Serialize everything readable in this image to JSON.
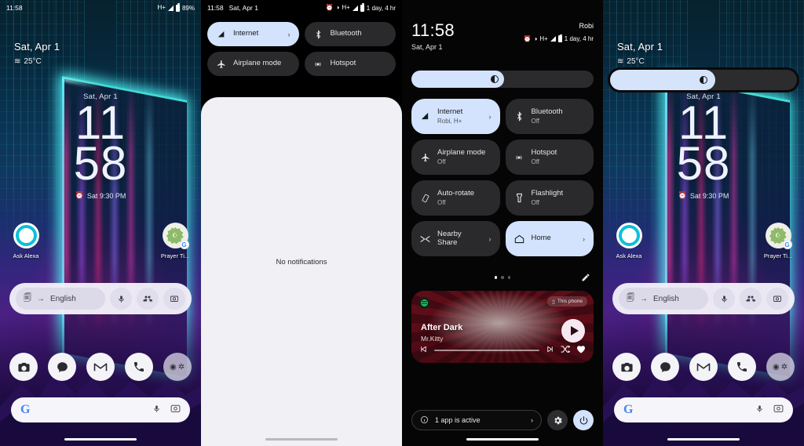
{
  "panels": {
    "home": {
      "status": {
        "time": "11:58",
        "network": "H+",
        "battery_pct": "89%"
      },
      "date": "Sat, Apr 1",
      "weather": "25°C",
      "clock": {
        "date": "Sat, Apr 1",
        "hours": "11",
        "minutes": "58",
        "alarm": "Sat 9:30 PM"
      },
      "icons": [
        {
          "label": "Ask Alexa",
          "icon": "alexa-icon"
        },
        {
          "label": "Prayer Ti...",
          "icon": "prayer-times-icon"
        }
      ],
      "translate_widget": {
        "language": "English",
        "arrow": "→",
        "buttons": [
          "mic-icon",
          "conversation-icon",
          "camera-icon"
        ],
        "lens_icon": "translate-lens-icon"
      },
      "dock": [
        "camera-icon",
        "messages-icon",
        "gmail-icon",
        "phone-icon",
        "folder-icon"
      ],
      "search": {
        "logo": "google-g",
        "placeholder": "",
        "mic": "mic-icon",
        "lens": "lens-icon"
      }
    },
    "notifications": {
      "status": {
        "time": "11:58",
        "date": "Sat, Apr 1",
        "battery_text": "1 day, 4 hr",
        "network": "H+"
      },
      "tiles": [
        {
          "label": "Internet",
          "state": "on",
          "chevron": "›",
          "icon": "signal-icon"
        },
        {
          "label": "Bluetooth",
          "state": "off",
          "icon": "bluetooth-icon"
        },
        {
          "label": "Airplane mode",
          "state": "off",
          "icon": "airplane-icon"
        },
        {
          "label": "Hotspot",
          "state": "off",
          "icon": "hotspot-icon"
        }
      ],
      "empty_text": "No notifications"
    },
    "quicksettings": {
      "time": "11:58",
      "date": "Sat, Apr 1",
      "carrier": "Robi",
      "battery_text": "1 day, 4 hr",
      "network": "H+",
      "brightness_pct": 51,
      "tiles": [
        {
          "label": "Internet",
          "sub": "Robi, H+",
          "state": "on",
          "chevron": "›",
          "icon": "signal-icon"
        },
        {
          "label": "Bluetooth",
          "sub": "Off",
          "state": "off",
          "icon": "bluetooth-icon"
        },
        {
          "label": "Airplane mode",
          "sub": "Off",
          "state": "off",
          "icon": "airplane-icon"
        },
        {
          "label": "Hotspot",
          "sub": "Off",
          "state": "off",
          "icon": "hotspot-icon"
        },
        {
          "label": "Auto-rotate",
          "sub": "Off",
          "state": "off",
          "icon": "autorotate-icon"
        },
        {
          "label": "Flashlight",
          "sub": "Off",
          "state": "off",
          "icon": "flashlight-icon"
        },
        {
          "label": "Nearby Share",
          "sub": "",
          "state": "off",
          "chevron": "›",
          "icon": "nearby-share-icon"
        },
        {
          "label": "Home",
          "sub": "",
          "state": "on",
          "chevron": "›",
          "icon": "home-icon"
        }
      ],
      "page_dots": {
        "count": 3,
        "active": 0
      },
      "edit_icon": "pencil-icon",
      "media": {
        "title": "After Dark",
        "artist": "Mr.Kitty",
        "device": "This phone",
        "device_icon": "phone-icon",
        "app_icon": "spotify-icon",
        "controls": [
          "prev-icon",
          "seekbar",
          "next-icon",
          "shuffle-icon",
          "favorite-icon"
        ],
        "play_icon": "play-icon",
        "progress_pct": 5
      },
      "footer": {
        "apps_active": "1 app is active",
        "chevron": "›",
        "info_icon": "info-icon",
        "settings_icon": "gear-icon",
        "power_icon": "power-icon"
      }
    },
    "home_brightness": {
      "status": {
        "time": "",
        "network": "",
        "battery_pct": ""
      },
      "date": "Sat, Apr 1",
      "weather": "25°C",
      "clock": {
        "date": "Sat, Apr 1",
        "hours": "11",
        "minutes": "58",
        "alarm": "Sat 9:30 PM"
      },
      "icons": [
        {
          "label": "Ask Alexa",
          "icon": "alexa-icon"
        },
        {
          "label": "Prayer Ti...",
          "icon": "prayer-times-icon"
        }
      ],
      "translate_widget": {
        "language": "English",
        "arrow": "→"
      },
      "brightness_pct": 55,
      "search": {
        "logo": "google-g"
      }
    }
  },
  "colors": {
    "accent_tile_on": "#d3e3fd",
    "tile_off": "#2a2a2c",
    "sheet_bg": "#f1f0f4",
    "panel_bg": "#000000",
    "text_light": "#e6e6e8"
  }
}
